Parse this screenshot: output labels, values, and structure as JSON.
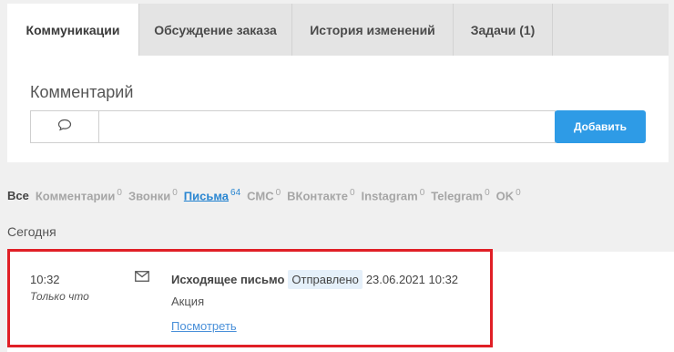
{
  "tabs": [
    {
      "label": "Коммуникации",
      "active": true
    },
    {
      "label": "Обсуждение заказа",
      "active": false
    },
    {
      "label": "История изменений",
      "active": false
    },
    {
      "label": "Задачи (1)",
      "active": false
    }
  ],
  "comment": {
    "label": "Комментарий",
    "input_value": "",
    "add_button": "Добавить"
  },
  "filters": [
    {
      "label": "Все",
      "count": ""
    },
    {
      "label": "Комментарии",
      "count": "0"
    },
    {
      "label": "Звонки",
      "count": "0"
    },
    {
      "label": "Письма",
      "count": "64"
    },
    {
      "label": "СМС",
      "count": "0"
    },
    {
      "label": "ВКонтакте",
      "count": "0"
    },
    {
      "label": "Instagram",
      "count": "0"
    },
    {
      "label": "Telegram",
      "count": "0"
    },
    {
      "label": "OK",
      "count": "0"
    }
  ],
  "section": {
    "today": "Сегодня"
  },
  "event": {
    "time": "10:32",
    "relative": "Только что",
    "icon": "envelope-icon",
    "type": "Исходящее письмо",
    "status": "Отправлено",
    "date": "23.06.2021 10:32",
    "subject": "Акция",
    "link": "Посмотреть"
  },
  "colors": {
    "accent": "#2e9be6",
    "highlight": "#e01f26",
    "status_bg": "#e5f0fa",
    "link": "#4a90d9"
  }
}
